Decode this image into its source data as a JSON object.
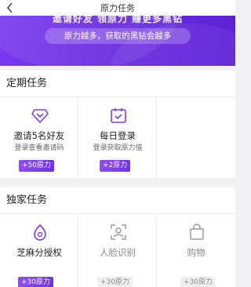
{
  "nav": {
    "title": "原力任务"
  },
  "banner": {
    "headline": "邀请好友  领原力  赚更多黑钻",
    "pill": "原力越多，获取的黑钻会越多"
  },
  "periodic": {
    "title": "定期任务",
    "tasks": [
      {
        "name": "邀请5名好友",
        "desc": "登录查看邀请码",
        "reward": "+50原力",
        "icon": "diamond-icon"
      },
      {
        "name": "每日登录",
        "desc": "登录获取原力值",
        "reward": "+2原力",
        "icon": "calendar-check-icon"
      }
    ]
  },
  "exclusive": {
    "title": "独家任务",
    "tasks": [
      {
        "name": "芝麻分授权",
        "reward": "+30原力",
        "icon": "sesame-icon"
      },
      {
        "name": "人脸识别",
        "reward": "+30原力",
        "icon": "face-scan-icon"
      },
      {
        "name": "购物",
        "reward": "+30原力",
        "icon": "shopping-bag-icon"
      }
    ]
  },
  "colors": {
    "accent": "#7b3cf0",
    "accent_dark": "#5d22d6",
    "muted": "#9a9a9a"
  }
}
